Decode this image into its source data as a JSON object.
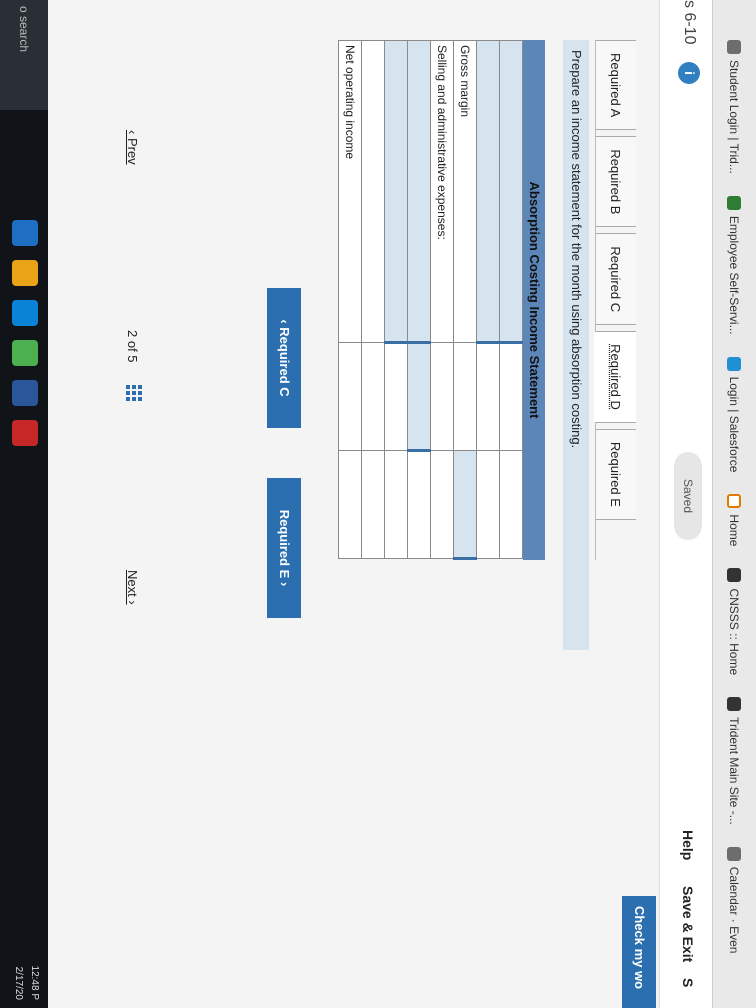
{
  "bookmarks": [
    {
      "label": "Student Login | Trid...",
      "icon": "gear-icon"
    },
    {
      "label": "Employee Self-Servi...",
      "icon": "document-icon"
    },
    {
      "label": "Login | Salesforce",
      "icon": "cloud-icon"
    },
    {
      "label": "Home",
      "icon": "home-icon"
    },
    {
      "label": "CNSSS :: Home",
      "icon": "globe-icon"
    },
    {
      "label": "Trident Main Site -...",
      "icon": "globe-icon"
    },
    {
      "label": "Calendar · Even",
      "icon": "gear-icon"
    }
  ],
  "header": {
    "chapter": "s 6-10",
    "info_badge": "i",
    "saved": "Saved",
    "help": "Help",
    "save_exit": "Save & Exit",
    "submit": "S",
    "check_work": "Check my wo"
  },
  "tabs": [
    "Required A",
    "Required B",
    "Required C",
    "Required D",
    "Required E"
  ],
  "active_tab": "Required D",
  "prompt": "Prepare an income statement for the month using absorption costing.",
  "statement": {
    "title": "Absorption Costing Income Statement",
    "rows": [
      {
        "label": ""
      },
      {
        "label": ""
      },
      {
        "label": "Gross margin"
      },
      {
        "label": "Selling and administrative expenses:"
      },
      {
        "label": ""
      },
      {
        "label": ""
      },
      {
        "label": ""
      },
      {
        "label": "Net operating income"
      }
    ]
  },
  "nav": {
    "prev_tab": "Required C",
    "next_tab": "Required E"
  },
  "pager": {
    "prev": "Prev",
    "count": "2 of 5",
    "next": "Next"
  },
  "taskbar": {
    "search": "o search",
    "time": "12:48 P",
    "date": "2/17/20"
  }
}
